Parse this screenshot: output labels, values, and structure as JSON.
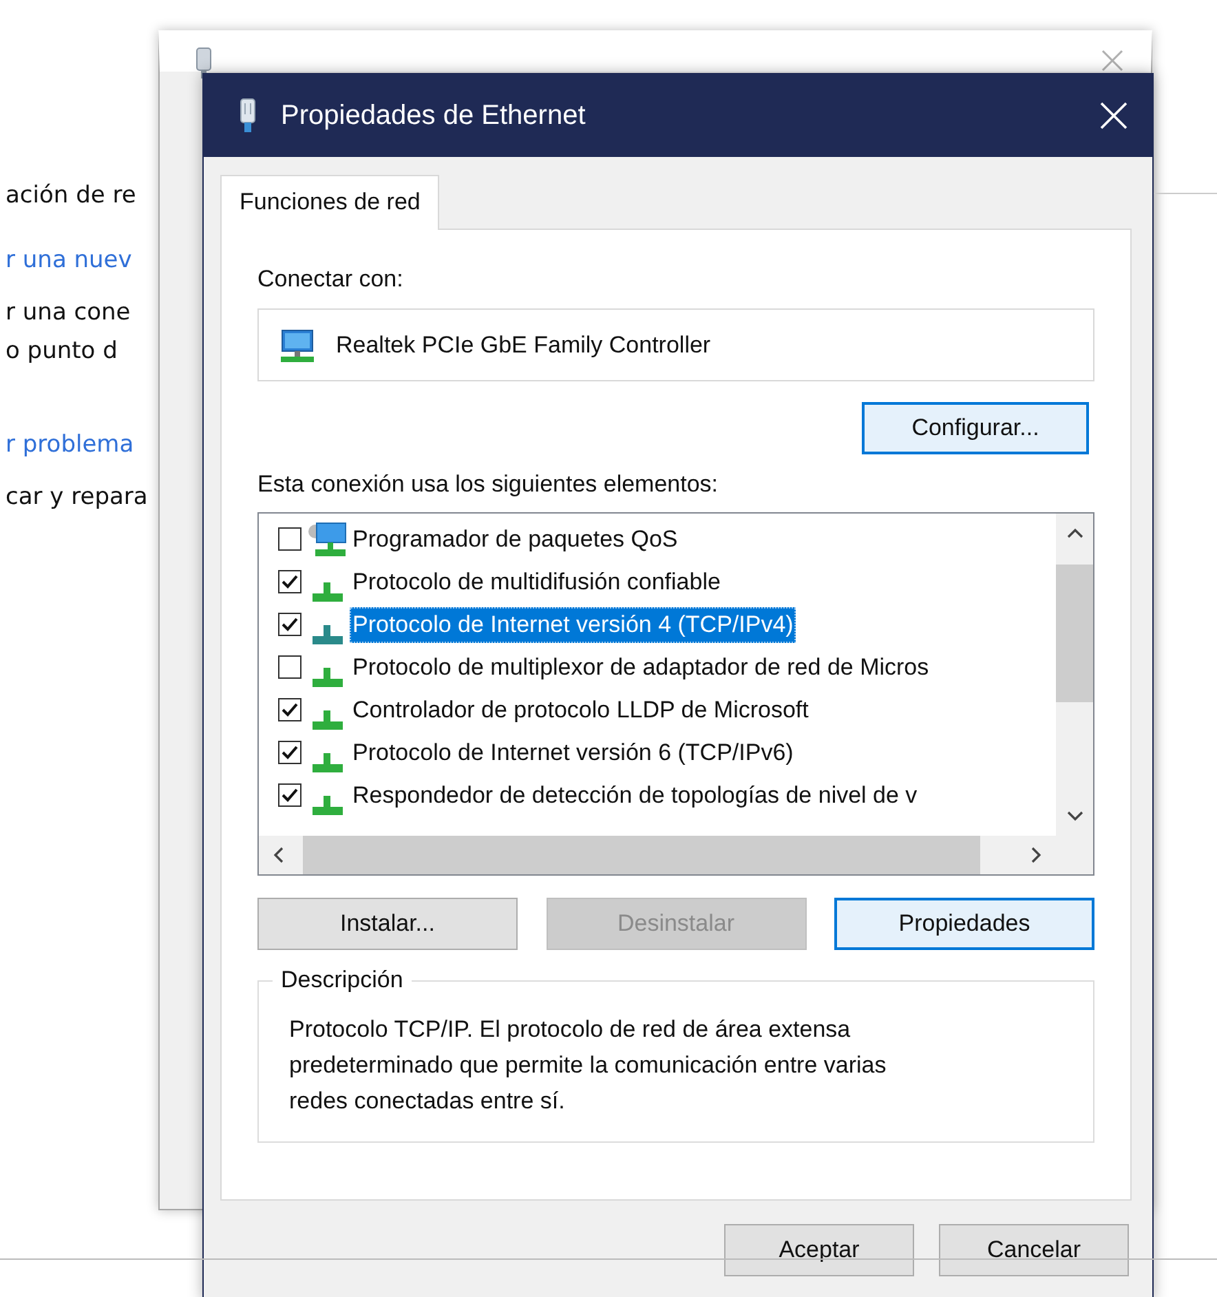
{
  "background_page": {
    "lines": [
      {
        "text": "ación de re",
        "kind": "text"
      },
      {
        "text": "r una nuev",
        "kind": "link"
      },
      {
        "text": "r una cone",
        "kind": "text"
      },
      {
        "text": "o punto d",
        "kind": "text"
      },
      {
        "text": "r problema",
        "kind": "link"
      },
      {
        "text": "car y repara",
        "kind": "text"
      }
    ]
  },
  "dialog": {
    "title": "Propiedades de Ethernet",
    "tabs": [
      {
        "label": "Funciones de red",
        "selected": true
      }
    ],
    "connect_label": "Conectar con:",
    "adapter": "Realtek PCIe GbE Family Controller",
    "configure_button": "Configurar...",
    "components_label": "Esta conexión usa los siguientes elementos:",
    "components": [
      {
        "label": "Programador de paquetes QoS",
        "kind": "scheduler",
        "checked": false,
        "selected": false
      },
      {
        "label": "Protocolo de multidifusión confiable",
        "kind": "protocol",
        "checked": true,
        "selected": false
      },
      {
        "label": "Protocolo de Internet versión 4 (TCP/IPv4)",
        "kind": "protocol",
        "checked": true,
        "selected": true
      },
      {
        "label": "Protocolo de multiplexor de adaptador de red de Micros",
        "kind": "protocol",
        "checked": false,
        "selected": false
      },
      {
        "label": "Controlador de protocolo LLDP de Microsoft",
        "kind": "protocol",
        "checked": true,
        "selected": false
      },
      {
        "label": "Protocolo de Internet versión 6 (TCP/IPv6)",
        "kind": "protocol",
        "checked": true,
        "selected": false
      },
      {
        "label": "Respondedor de detección de topologías de nivel de v",
        "kind": "protocol",
        "checked": true,
        "selected": false
      }
    ],
    "buttons": [
      {
        "label": "Instalar...",
        "disabled": false,
        "focused": false
      },
      {
        "label": "Desinstalar",
        "disabled": true,
        "focused": false
      },
      {
        "label": "Propiedades",
        "disabled": false,
        "focused": true
      }
    ],
    "description": {
      "legend": "Descripción",
      "text": "Protocolo TCP/IP. El protocolo de red de área extensa predeterminado que permite la comunicación entre varias redes conectadas entre sí."
    },
    "footer_buttons": [
      "Aceptar",
      "Cancelar"
    ]
  }
}
